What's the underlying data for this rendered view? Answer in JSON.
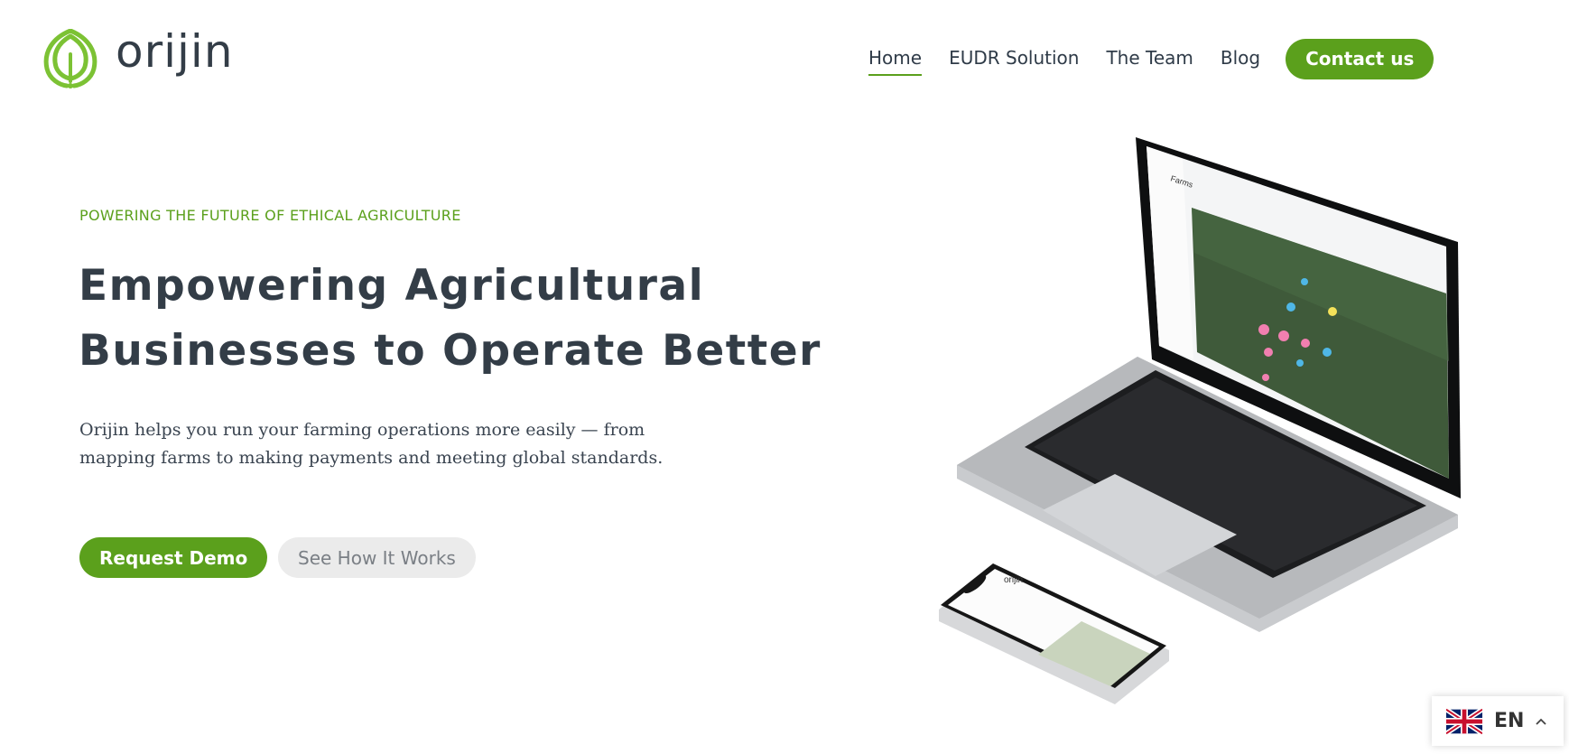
{
  "brand": {
    "name": "orijin",
    "color_primary": "#5ba01c",
    "color_text": "#333d47"
  },
  "nav": {
    "items": [
      {
        "label": "Home",
        "active": true
      },
      {
        "label": "EUDR Solution",
        "active": false
      },
      {
        "label": "The Team",
        "active": false
      },
      {
        "label": "Blog",
        "active": false
      }
    ],
    "cta_label": "Contact us"
  },
  "hero": {
    "eyebrow": "POWERING THE FUTURE OF ETHICAL AGRICULTURE",
    "headline_line1": "Empowering Agricultural",
    "headline_line2": "Businesses to Operate Better",
    "subtext_line1": "Orijin helps you run your farming operations more easily — from",
    "subtext_line2": "mapping farms to making payments and meeting global standards.",
    "primary_button": "Request Demo",
    "secondary_button": "See How It Works"
  },
  "illustration": {
    "laptop_screen_title": "Farms",
    "phone_brand": "orijin"
  },
  "language": {
    "code": "EN",
    "flag_icon": "uk-flag-icon"
  }
}
